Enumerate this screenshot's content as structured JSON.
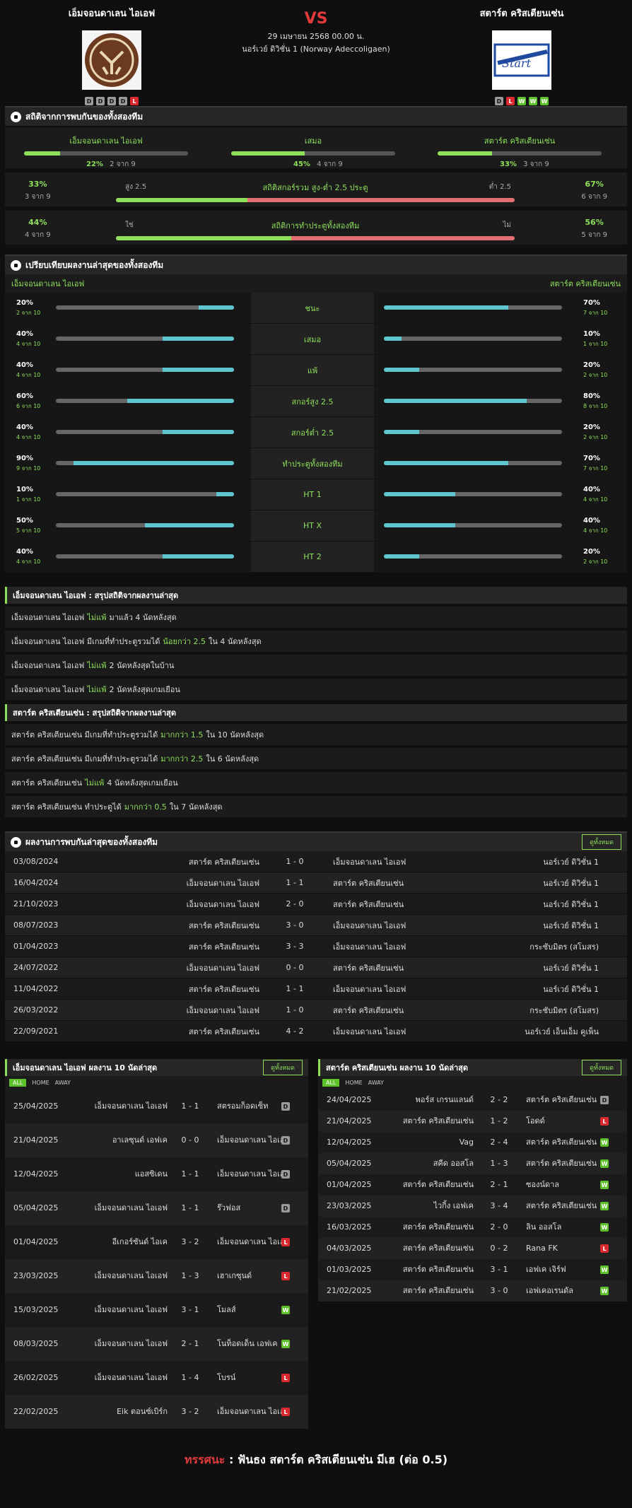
{
  "header": {
    "home_team": "เอ็มจอนดาเลน ไอเอฟ",
    "away_team": "สตาร์ต คริสเตียนเซ่น",
    "vs": "VS",
    "date": "29 เมษายน 2568 00.00 น.",
    "league": "นอร์เวย์ ดิวิชั่น 1 (Norway Adeccoligaen)",
    "home_form": [
      "D",
      "D",
      "D",
      "D",
      "L"
    ],
    "away_form": [
      "D",
      "L",
      "W",
      "W",
      "W"
    ]
  },
  "h2h": {
    "title": "สถิติจากการพบกันของทั้งสองทีม",
    "items": [
      {
        "label": "เอ็มจอนดาเลน ไอเอฟ",
        "pct": "22%",
        "count": "2 จาก 9",
        "value": 0.22
      },
      {
        "label": "เสมอ",
        "pct": "45%",
        "count": "4 จาก 9",
        "value": 0.45
      },
      {
        "label": "สตาร์ต คริสเตียนเซ่น",
        "pct": "33%",
        "count": "3 จาก 9",
        "value": 0.33
      }
    ]
  },
  "ou": {
    "title": "สถิติสกอร์รวม สูง-ต่ำ 2.5 ประตู",
    "left_label": "สูง 2.5",
    "right_label": "ต่ำ 2.5",
    "left_pct": "33%",
    "left_count": "3 จาก 9",
    "right_pct": "67%",
    "right_count": "6 จาก 9",
    "value": 0.33
  },
  "btts": {
    "title": "สถิติการทำประตูทั้งสองทีม",
    "left_label": "ใช่",
    "right_label": "ไม่",
    "left_pct": "44%",
    "left_count": "4 จาก 9",
    "right_pct": "56%",
    "right_count": "5 จาก 9",
    "value": 0.44
  },
  "compare": {
    "title": "เปรียบเทียบผลงานล่าสุดของทั้งสองทีม",
    "home": "เอ็มจอนดาเลน ไอเอฟ",
    "away": "สตาร์ต คริสเตียนเซ่น",
    "rows": [
      {
        "label": "ชนะ",
        "hp": "20%",
        "hc": "2 จาก 10",
        "hv": 0.2,
        "ap": "70%",
        "ac": "7 จาก 10",
        "av": 0.7
      },
      {
        "label": "เสมอ",
        "hp": "40%",
        "hc": "4 จาก 10",
        "hv": 0.4,
        "ap": "10%",
        "ac": "1 จาก 10",
        "av": 0.1
      },
      {
        "label": "แพ้",
        "hp": "40%",
        "hc": "4 จาก 10",
        "hv": 0.4,
        "ap": "20%",
        "ac": "2 จาก 10",
        "av": 0.2
      },
      {
        "label": "สกอร์สูง 2.5",
        "hp": "60%",
        "hc": "6 จาก 10",
        "hv": 0.6,
        "ap": "80%",
        "ac": "8 จาก 10",
        "av": 0.8
      },
      {
        "label": "สกอร์ต่ำ 2.5",
        "hp": "40%",
        "hc": "4 จาก 10",
        "hv": 0.4,
        "ap": "20%",
        "ac": "2 จาก 10",
        "av": 0.2
      },
      {
        "label": "ทำประตูทั้งสองทีม",
        "hp": "90%",
        "hc": "9 จาก 10",
        "hv": 0.9,
        "ap": "70%",
        "ac": "7 จาก 10",
        "av": 0.7
      },
      {
        "label": "HT 1",
        "hp": "10%",
        "hc": "1 จาก 10",
        "hv": 0.1,
        "ap": "40%",
        "ac": "4 จาก 10",
        "av": 0.4
      },
      {
        "label": "HT X",
        "hp": "50%",
        "hc": "5 จาก 10",
        "hv": 0.5,
        "ap": "40%",
        "ac": "4 จาก 10",
        "av": 0.4
      },
      {
        "label": "HT 2",
        "hp": "40%",
        "hc": "4 จาก 10",
        "hv": 0.4,
        "ap": "20%",
        "ac": "2 จาก 10",
        "av": 0.2
      }
    ]
  },
  "home_summary": {
    "title": "เอ็มจอนดาเลน ไอเอฟ : สรุปสถิติจากผลงานล่าสุด",
    "rows": [
      [
        "เอ็มจอนดาเลน ไอเอฟ",
        "ไม่แพ้",
        "มาแล้ว 4 นัดหลังสุด"
      ],
      [
        "เอ็มจอนดาเลน ไอเอฟ มีเกมที่ทำประตูรวมได้",
        "น้อยกว่า 2.5",
        "ใน 4 นัดหลังสุด"
      ],
      [
        "เอ็มจอนดาเลน ไอเอฟ",
        "ไม่แพ้",
        "2 นัดหลังสุดในบ้าน"
      ],
      [
        "เอ็มจอนดาเลน ไอเอฟ",
        "ไม่แพ้",
        "2 นัดหลังสุดเกมเยือน"
      ]
    ]
  },
  "away_summary": {
    "title": "สตาร์ต คริสเตียนเซ่น : สรุปสถิติจากผลงานล่าสุด",
    "rows": [
      [
        "สตาร์ต คริสเตียนเซ่น มีเกมที่ทำประตูรวมได้",
        "มากกว่า 1.5",
        "ใน 10 นัดหลังสุด"
      ],
      [
        "สตาร์ต คริสเตียนเซ่น มีเกมที่ทำประตูรวมได้",
        "มากกว่า 2.5",
        "ใน 6 นัดหลังสุด"
      ],
      [
        "สตาร์ต คริสเตียนเซ่น",
        "ไม่แพ้",
        "4 นัดหลังสุดเกมเยือน"
      ],
      [
        "สตาร์ต คริสเตียนเซ่น ทำประตูได้",
        "มากกว่า 0.5",
        "ใน 7 นัดหลังสุด"
      ]
    ]
  },
  "h2h_matches": {
    "title": "ผลงานการพบกันล่าสุดของทั้งสองทีม",
    "view_all": "ดูทั้งหมด",
    "rows": [
      [
        "03/08/2024",
        "สตาร์ต คริสเตียนเซ่น",
        "1 - 0",
        "เอ็มจอนดาเลน ไอเอฟ",
        "นอร์เวย์ ดิวิชั่น 1"
      ],
      [
        "16/04/2024",
        "เอ็มจอนดาเลน ไอเอฟ",
        "1 - 1",
        "สตาร์ต คริสเตียนเซ่น",
        "นอร์เวย์ ดิวิชั่น 1"
      ],
      [
        "21/10/2023",
        "เอ็มจอนดาเลน ไอเอฟ",
        "2 - 0",
        "สตาร์ต คริสเตียนเซ่น",
        "นอร์เวย์ ดิวิชั่น 1"
      ],
      [
        "08/07/2023",
        "สตาร์ต คริสเตียนเซ่น",
        "3 - 0",
        "เอ็มจอนดาเลน ไอเอฟ",
        "นอร์เวย์ ดิวิชั่น 1"
      ],
      [
        "01/04/2023",
        "สตาร์ต คริสเตียนเซ่น",
        "3 - 3",
        "เอ็มจอนดาเลน ไอเอฟ",
        "กระชับมิตร (สโมสร)"
      ],
      [
        "24/07/2022",
        "เอ็มจอนดาเลน ไอเอฟ",
        "0 - 0",
        "สตาร์ต คริสเตียนเซ่น",
        "นอร์เวย์ ดิวิชั่น 1"
      ],
      [
        "11/04/2022",
        "สตาร์ต คริสเตียนเซ่น",
        "1 - 1",
        "เอ็มจอนดาเลน ไอเอฟ",
        "นอร์เวย์ ดิวิชั่น 1"
      ],
      [
        "26/03/2022",
        "เอ็มจอนดาเลน ไอเอฟ",
        "1 - 0",
        "สตาร์ต คริสเตียนเซ่น",
        "กระชับมิตร (สโมสร)"
      ],
      [
        "22/09/2021",
        "สตาร์ต คริสเตียนเซ่น",
        "4 - 2",
        "เอ็มจอนดาเลน ไอเอฟ",
        "นอร์เวย์ เอ็นเอ็ม คูเพ็น"
      ]
    ]
  },
  "home_last10": {
    "title": "เอ็มจอนดาเลน ไอเอฟ ผลงาน 10 นัดล่าสุด",
    "view_all": "ดูทั้งหมด",
    "tabs": [
      "ALL",
      "HOME",
      "AWAY"
    ],
    "rows": [
      [
        "25/04/2025",
        "เอ็มจอนดาเลน ไอเอฟ",
        "1 - 1",
        "สตรอมก็อดเซ็ท",
        "D"
      ],
      [
        "21/04/2025",
        "อาเลซุนด์ เอฟเค",
        "0 - 0",
        "เอ็มจอนดาเลน ไอเอฟ",
        "D"
      ],
      [
        "12/04/2025",
        "แอสซิเดน",
        "1 - 1",
        "เอ็มจอนดาเลน ไอเอฟ",
        "D"
      ],
      [
        "05/04/2025",
        "เอ็มจอนดาเลน ไอเอฟ",
        "1 - 1",
        "ร๊วฟอส",
        "D"
      ],
      [
        "01/04/2025",
        "อีเกอร์ซันด์ ไอเค",
        "3 - 2",
        "เอ็มจอนดาเลน ไอเอฟ",
        "L"
      ],
      [
        "23/03/2025",
        "เอ็มจอนดาเลน ไอเอฟ",
        "1 - 3",
        "เฮาเกซุนด์",
        "L"
      ],
      [
        "15/03/2025",
        "เอ็มจอนดาเลน ไอเอฟ",
        "3 - 1",
        "โมลส์",
        "W"
      ],
      [
        "08/03/2025",
        "เอ็มจอนดาเลน ไอเอฟ",
        "2 - 1",
        "โนท็อดเด็น เอฟเค",
        "W"
      ],
      [
        "26/02/2025",
        "เอ็มจอนดาเลน ไอเอฟ",
        "1 - 4",
        "โบรน์",
        "L"
      ],
      [
        "22/02/2025",
        "Eik ตอนซ์เบิร์ก",
        "3 - 2",
        "เอ็มจอนดาเลน ไอเอฟ",
        "L"
      ]
    ]
  },
  "away_last10": {
    "title": "สตาร์ต คริสเตียนเซ่น ผลงาน 10 นัดล่าสุด",
    "view_all": "ดูทั้งหมด",
    "tabs": [
      "ALL",
      "HOME",
      "AWAY"
    ],
    "rows": [
      [
        "24/04/2025",
        "พอร์ส เกรนแลนด์",
        "2 - 2",
        "สตาร์ต คริสเตียนเซ่น",
        "D"
      ],
      [
        "21/04/2025",
        "สตาร์ต คริสเตียนเซ่น",
        "1 - 2",
        "โอดด์",
        "L"
      ],
      [
        "12/04/2025",
        "Vag",
        "2 - 4",
        "สตาร์ต คริสเตียนเซ่น",
        "W"
      ],
      [
        "05/04/2025",
        "สคีด ออสโล",
        "1 - 3",
        "สตาร์ต คริสเตียนเซ่น",
        "W"
      ],
      [
        "01/04/2025",
        "สตาร์ต คริสเตียนเซ่น",
        "2 - 1",
        "ซองน์ดาล",
        "W"
      ],
      [
        "23/03/2025",
        "ไวกิ้ง เอฟเค",
        "3 - 4",
        "สตาร์ต คริสเตียนเซ่น",
        "W"
      ],
      [
        "16/03/2025",
        "สตาร์ต คริสเตียนเซ่น",
        "2 - 0",
        "ลิน ออสโล",
        "W"
      ],
      [
        "04/03/2025",
        "สตาร์ต คริสเตียนเซ่น",
        "0 - 2",
        "Rana FK",
        "L"
      ],
      [
        "01/03/2025",
        "สตาร์ต คริสเตียนเซ่น",
        "3 - 1",
        "เอฟเค เจิร์ฟ",
        "W"
      ],
      [
        "21/02/2025",
        "สตาร์ต คริสเตียนเซ่น",
        "3 - 0",
        "เอฟเคอเรนดัล",
        "W"
      ]
    ]
  },
  "footer": {
    "key": "ทรรศนะ",
    "sep": " : ",
    "text": "ฟันธง สตาร์ต คริสเตียนเซ่น มีเฮ (ต่อ 0.5)"
  },
  "colors": {
    "accent": "#8ee05a",
    "bar": "#5fc6d0",
    "red": "#e23a3a"
  }
}
